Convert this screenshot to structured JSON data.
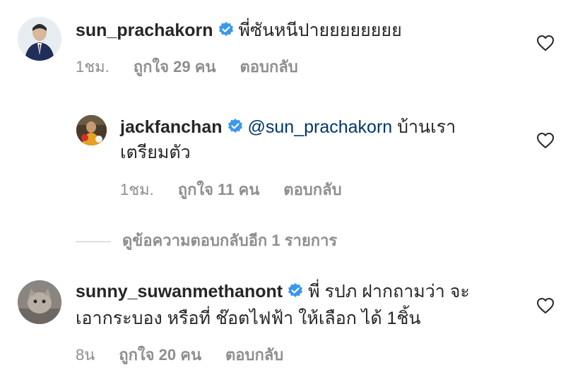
{
  "comments": [
    {
      "username": "sun_prachakorn",
      "text": "พี่ซันหนีปายยยยยยยย",
      "time": "1ชม.",
      "likes": "ถูกใจ 29 คน",
      "reply": "ตอบกลับ"
    },
    {
      "username": "jackfanchan",
      "mention": "@sun_prachakorn",
      "text_line1": "บ้านเรา",
      "text_line2": "เตรียมตัว",
      "time": "1ชม.",
      "likes": "ถูกใจ 11 คน",
      "reply": "ตอบกลับ"
    },
    {
      "username": "sunny_suwanmethanont",
      "text_line1": "พี่ รปภ ฝากถามว่า จะ",
      "text_line2": "เอากระบอง หรือที่ ช๊อตไฟฟ้า ให้เลือก ได้ 1ชิ้น",
      "time": "8น",
      "likes": "ถูกใจ 20 คน",
      "reply": "ตอบกลับ"
    }
  ],
  "view_replies": "ดูข้อความตอบกลับอีก 1 รายการ",
  "icons": {
    "verified": "verified-badge-icon",
    "heart": "heart-outline-icon"
  },
  "colors": {
    "text": "#262626",
    "secondary": "#8e8e8e",
    "mention": "#00376b",
    "verified": "#3897f0"
  }
}
